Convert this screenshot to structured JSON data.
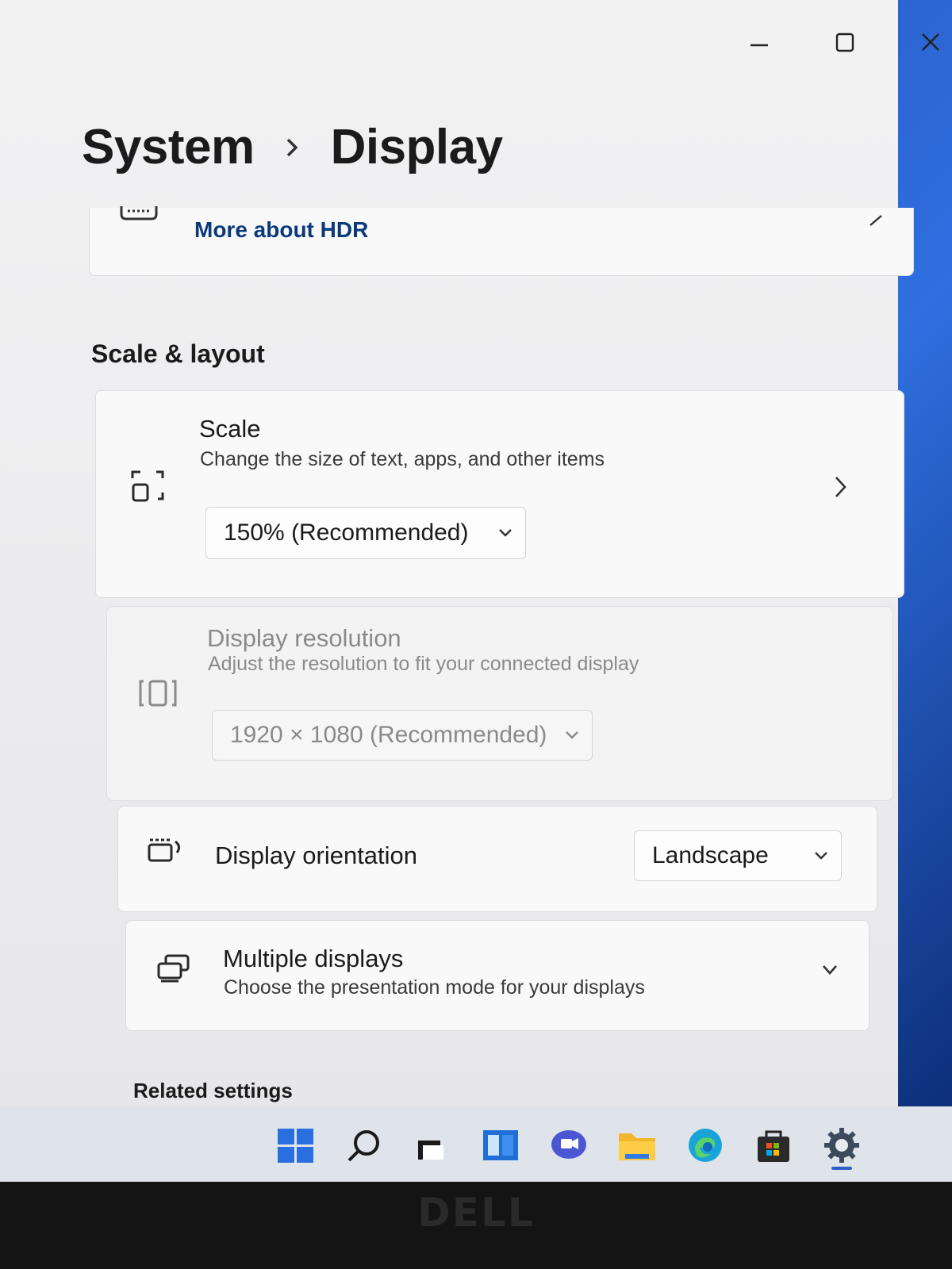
{
  "window_controls": {
    "minimize_icon": "minimize-icon",
    "maximize_icon": "maximize-icon",
    "close_icon": "close-icon"
  },
  "breadcrumb": {
    "parent": "System",
    "current": "Display"
  },
  "hdr": {
    "link": "More about HDR"
  },
  "scale_layout": {
    "section_title": "Scale & layout",
    "scale": {
      "title": "Scale",
      "description": "Change the size of text, apps, and other items",
      "selected": "150% (Recommended)"
    },
    "resolution": {
      "title": "Display resolution",
      "description": "Adjust the resolution to fit your connected display",
      "selected": "1920 × 1080 (Recommended)"
    },
    "orientation": {
      "title": "Display orientation",
      "selected": "Landscape"
    },
    "multiple_displays": {
      "title": "Multiple displays",
      "description": "Choose the presentation mode for your displays"
    }
  },
  "related_settings": {
    "title": "Related settings"
  },
  "taskbar": {
    "icons": [
      "start-icon",
      "search-icon",
      "task-view-icon",
      "widgets-icon",
      "chat-icon",
      "file-explorer-icon",
      "edge-icon",
      "store-icon",
      "settings-icon"
    ],
    "active": "settings-icon"
  },
  "bezel": {
    "brand": "DELL"
  }
}
